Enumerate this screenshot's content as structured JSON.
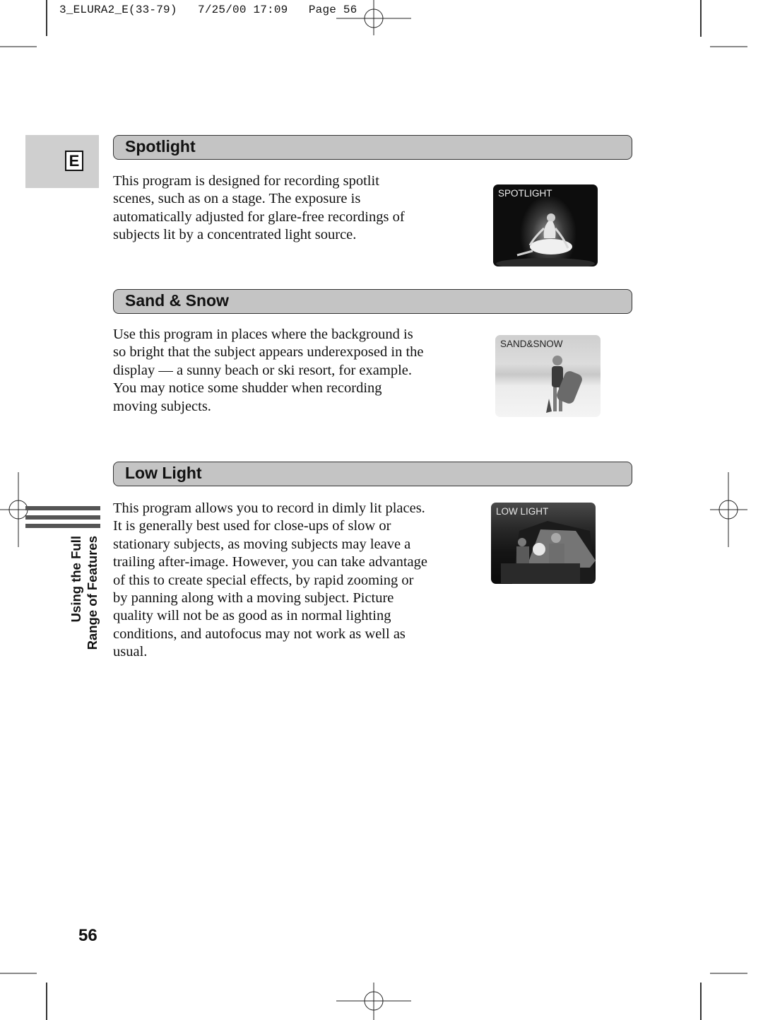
{
  "print_slug": "3_ELURA2_E(33-79)   7/25/00 17:09   Page 56",
  "language_tab": "E",
  "sections": [
    {
      "title": "Spotlight",
      "body": "This program is designed for recording spotlit scenes, such as on a stage. The exposure is automatically adjusted for glare-free recordings of subjects lit by a concentrated light source.",
      "image_label": "SPOTLIGHT",
      "image_subject": "ballerina seated on a dark stage under a spotlight"
    },
    {
      "title": "Sand & Snow",
      "body": "Use this program in places where the background is so bright that the subject appears underexposed in the display — a sunny beach or ski resort, for example. You may notice some shudder when recording moving subjects.",
      "image_label": "SAND&SNOW",
      "image_subject": "surfer holding a bodyboard on a bright beach"
    },
    {
      "title": "Low Light",
      "body": "This program allows you to record in dimly lit places. It is generally best used for close-ups of slow or stationary subjects, as moving subjects may leave a trailing after-image. However, you can take advantage of this to create special effects, by rapid zooming or by panning along with a moving subject. Picture quality will not be as good as in normal lighting conditions, and autofocus may not work as well as usual.",
      "image_label": "LOW LIGHT",
      "image_subject": "people at a table in front of a tent at night"
    }
  ],
  "side_label": [
    "Using the Full",
    "Range of Features"
  ],
  "page_number": "56",
  "colors": {
    "header_fill": "#c4c4c4",
    "tab_fill": "#cfcfcf",
    "side_bars": "#555555",
    "text": "#111111"
  }
}
